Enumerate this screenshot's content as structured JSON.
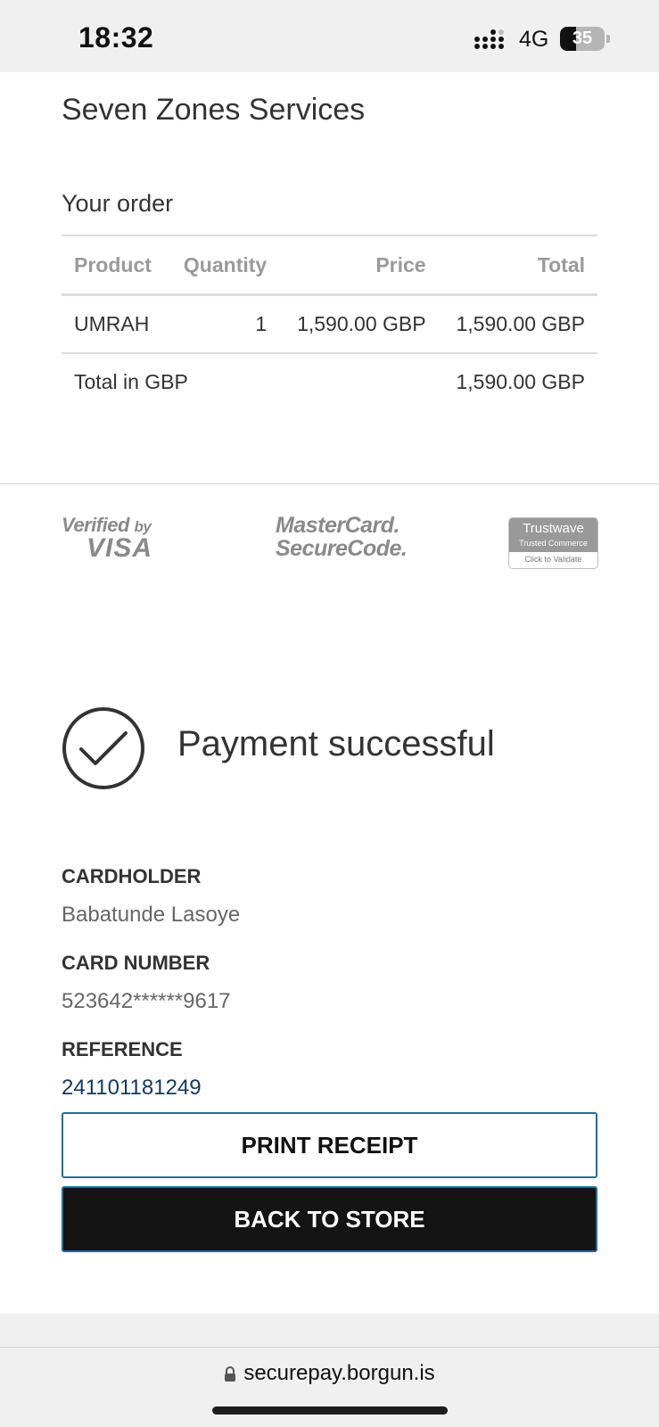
{
  "status_bar": {
    "time": "18:32",
    "network": "4G",
    "battery_level": "35"
  },
  "merchant": {
    "name": "Seven Zones Services"
  },
  "order": {
    "title": "Your order",
    "headers": {
      "product": "Product",
      "quantity": "Quantity",
      "price": "Price",
      "total": "Total"
    },
    "items": [
      {
        "product": "UMRAH",
        "quantity": "1",
        "price": "1,590.00 GBP",
        "total": "1,590.00 GBP"
      }
    ],
    "total_label": "Total in GBP",
    "total_value": "1,590.00 GBP"
  },
  "security_logos": {
    "visa_line1": "Verified",
    "visa_by": "by",
    "visa_line2": "VISA",
    "mastercard_line1": "MasterCard.",
    "mastercard_line2": "SecureCode.",
    "trustwave_line1": "Trustwave",
    "trustwave_line2": "Trusted Commerce",
    "trustwave_line3": "Click to Validate"
  },
  "result": {
    "message": "Payment successful",
    "icon": "checkmark-circle-icon"
  },
  "details": {
    "cardholder_label": "CARDHOLDER",
    "cardholder_value": "Babatunde Lasoye",
    "card_number_label": "CARD NUMBER",
    "card_number_value": "523642******9617",
    "reference_label": "REFERENCE",
    "reference_value": "241101181249"
  },
  "buttons": {
    "print_receipt": "PRINT RECEIPT",
    "back_to_store": "BACK TO STORE"
  },
  "browser": {
    "url": "securepay.borgun.is"
  },
  "colors": {
    "button_border": "#1e6e9e",
    "button_dark": "#141414",
    "reference_link": "#12385e"
  }
}
